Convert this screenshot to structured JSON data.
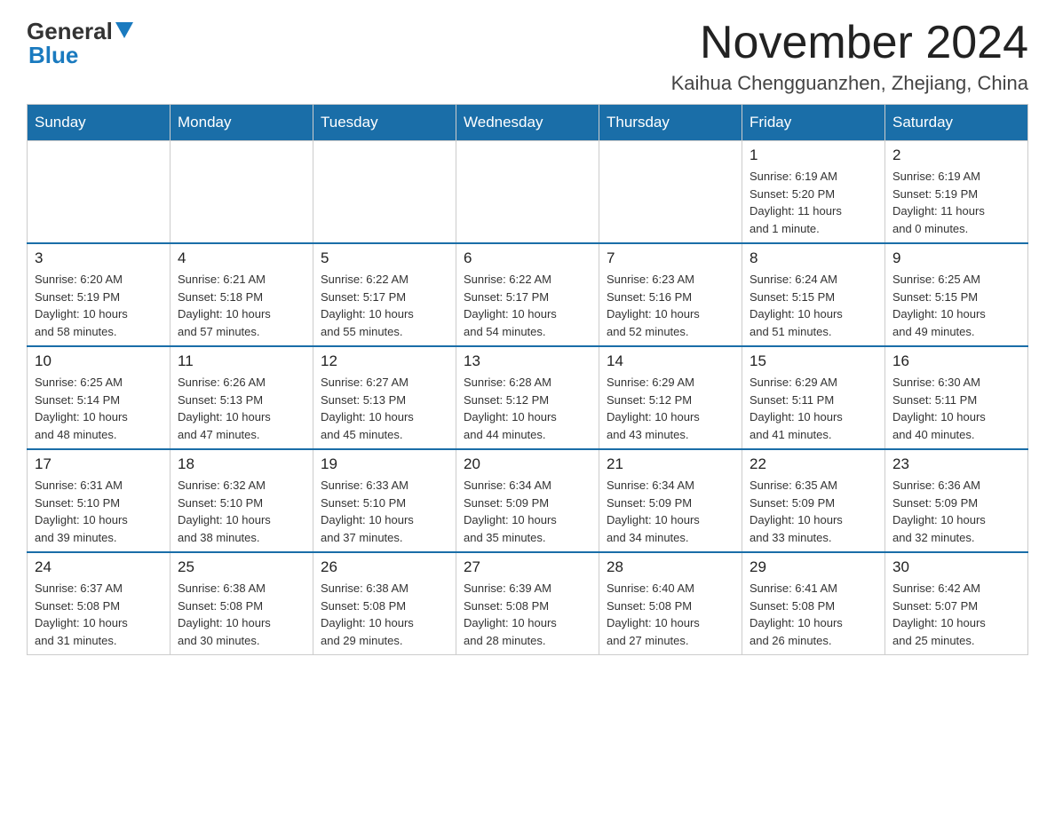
{
  "header": {
    "logo_general": "General",
    "logo_blue": "Blue",
    "month_title": "November 2024",
    "location": "Kaihua Chengguanzhen, Zhejiang, China"
  },
  "weekdays": [
    "Sunday",
    "Monday",
    "Tuesday",
    "Wednesday",
    "Thursday",
    "Friday",
    "Saturday"
  ],
  "weeks": [
    [
      {
        "day": "",
        "info": ""
      },
      {
        "day": "",
        "info": ""
      },
      {
        "day": "",
        "info": ""
      },
      {
        "day": "",
        "info": ""
      },
      {
        "day": "",
        "info": ""
      },
      {
        "day": "1",
        "info": "Sunrise: 6:19 AM\nSunset: 5:20 PM\nDaylight: 11 hours\nand 1 minute."
      },
      {
        "day": "2",
        "info": "Sunrise: 6:19 AM\nSunset: 5:19 PM\nDaylight: 11 hours\nand 0 minutes."
      }
    ],
    [
      {
        "day": "3",
        "info": "Sunrise: 6:20 AM\nSunset: 5:19 PM\nDaylight: 10 hours\nand 58 minutes."
      },
      {
        "day": "4",
        "info": "Sunrise: 6:21 AM\nSunset: 5:18 PM\nDaylight: 10 hours\nand 57 minutes."
      },
      {
        "day": "5",
        "info": "Sunrise: 6:22 AM\nSunset: 5:17 PM\nDaylight: 10 hours\nand 55 minutes."
      },
      {
        "day": "6",
        "info": "Sunrise: 6:22 AM\nSunset: 5:17 PM\nDaylight: 10 hours\nand 54 minutes."
      },
      {
        "day": "7",
        "info": "Sunrise: 6:23 AM\nSunset: 5:16 PM\nDaylight: 10 hours\nand 52 minutes."
      },
      {
        "day": "8",
        "info": "Sunrise: 6:24 AM\nSunset: 5:15 PM\nDaylight: 10 hours\nand 51 minutes."
      },
      {
        "day": "9",
        "info": "Sunrise: 6:25 AM\nSunset: 5:15 PM\nDaylight: 10 hours\nand 49 minutes."
      }
    ],
    [
      {
        "day": "10",
        "info": "Sunrise: 6:25 AM\nSunset: 5:14 PM\nDaylight: 10 hours\nand 48 minutes."
      },
      {
        "day": "11",
        "info": "Sunrise: 6:26 AM\nSunset: 5:13 PM\nDaylight: 10 hours\nand 47 minutes."
      },
      {
        "day": "12",
        "info": "Sunrise: 6:27 AM\nSunset: 5:13 PM\nDaylight: 10 hours\nand 45 minutes."
      },
      {
        "day": "13",
        "info": "Sunrise: 6:28 AM\nSunset: 5:12 PM\nDaylight: 10 hours\nand 44 minutes."
      },
      {
        "day": "14",
        "info": "Sunrise: 6:29 AM\nSunset: 5:12 PM\nDaylight: 10 hours\nand 43 minutes."
      },
      {
        "day": "15",
        "info": "Sunrise: 6:29 AM\nSunset: 5:11 PM\nDaylight: 10 hours\nand 41 minutes."
      },
      {
        "day": "16",
        "info": "Sunrise: 6:30 AM\nSunset: 5:11 PM\nDaylight: 10 hours\nand 40 minutes."
      }
    ],
    [
      {
        "day": "17",
        "info": "Sunrise: 6:31 AM\nSunset: 5:10 PM\nDaylight: 10 hours\nand 39 minutes."
      },
      {
        "day": "18",
        "info": "Sunrise: 6:32 AM\nSunset: 5:10 PM\nDaylight: 10 hours\nand 38 minutes."
      },
      {
        "day": "19",
        "info": "Sunrise: 6:33 AM\nSunset: 5:10 PM\nDaylight: 10 hours\nand 37 minutes."
      },
      {
        "day": "20",
        "info": "Sunrise: 6:34 AM\nSunset: 5:09 PM\nDaylight: 10 hours\nand 35 minutes."
      },
      {
        "day": "21",
        "info": "Sunrise: 6:34 AM\nSunset: 5:09 PM\nDaylight: 10 hours\nand 34 minutes."
      },
      {
        "day": "22",
        "info": "Sunrise: 6:35 AM\nSunset: 5:09 PM\nDaylight: 10 hours\nand 33 minutes."
      },
      {
        "day": "23",
        "info": "Sunrise: 6:36 AM\nSunset: 5:09 PM\nDaylight: 10 hours\nand 32 minutes."
      }
    ],
    [
      {
        "day": "24",
        "info": "Sunrise: 6:37 AM\nSunset: 5:08 PM\nDaylight: 10 hours\nand 31 minutes."
      },
      {
        "day": "25",
        "info": "Sunrise: 6:38 AM\nSunset: 5:08 PM\nDaylight: 10 hours\nand 30 minutes."
      },
      {
        "day": "26",
        "info": "Sunrise: 6:38 AM\nSunset: 5:08 PM\nDaylight: 10 hours\nand 29 minutes."
      },
      {
        "day": "27",
        "info": "Sunrise: 6:39 AM\nSunset: 5:08 PM\nDaylight: 10 hours\nand 28 minutes."
      },
      {
        "day": "28",
        "info": "Sunrise: 6:40 AM\nSunset: 5:08 PM\nDaylight: 10 hours\nand 27 minutes."
      },
      {
        "day": "29",
        "info": "Sunrise: 6:41 AM\nSunset: 5:08 PM\nDaylight: 10 hours\nand 26 minutes."
      },
      {
        "day": "30",
        "info": "Sunrise: 6:42 AM\nSunset: 5:07 PM\nDaylight: 10 hours\nand 25 minutes."
      }
    ]
  ]
}
